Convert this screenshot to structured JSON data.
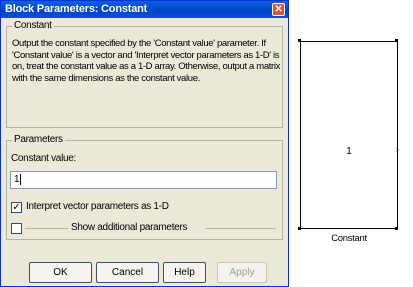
{
  "dialog": {
    "title": "Block Parameters: Constant",
    "close_glyph": "✕",
    "constant_group": {
      "legend": "Constant",
      "description": "Output the constant specified by the 'Constant value' parameter. If 'Constant value' is a vector and 'Interpret vector parameters as 1-D' is on, treat the constant value as a 1-D array. Otherwise, output a matrix with the same dimensions as the constant value."
    },
    "parameters_group": {
      "legend": "Parameters",
      "constant_value_label": "Constant value:",
      "constant_value": "1",
      "interpret_checkbox_label": "Interpret vector parameters as 1-D",
      "interpret_checked": true,
      "show_additional_label": "Show additional parameters",
      "show_additional_checked": false
    },
    "buttons": {
      "ok": "OK",
      "cancel": "Cancel",
      "help": "Help",
      "apply": "Apply"
    }
  },
  "block": {
    "value": "1",
    "name": "Constant",
    "port_glyph": "›"
  }
}
